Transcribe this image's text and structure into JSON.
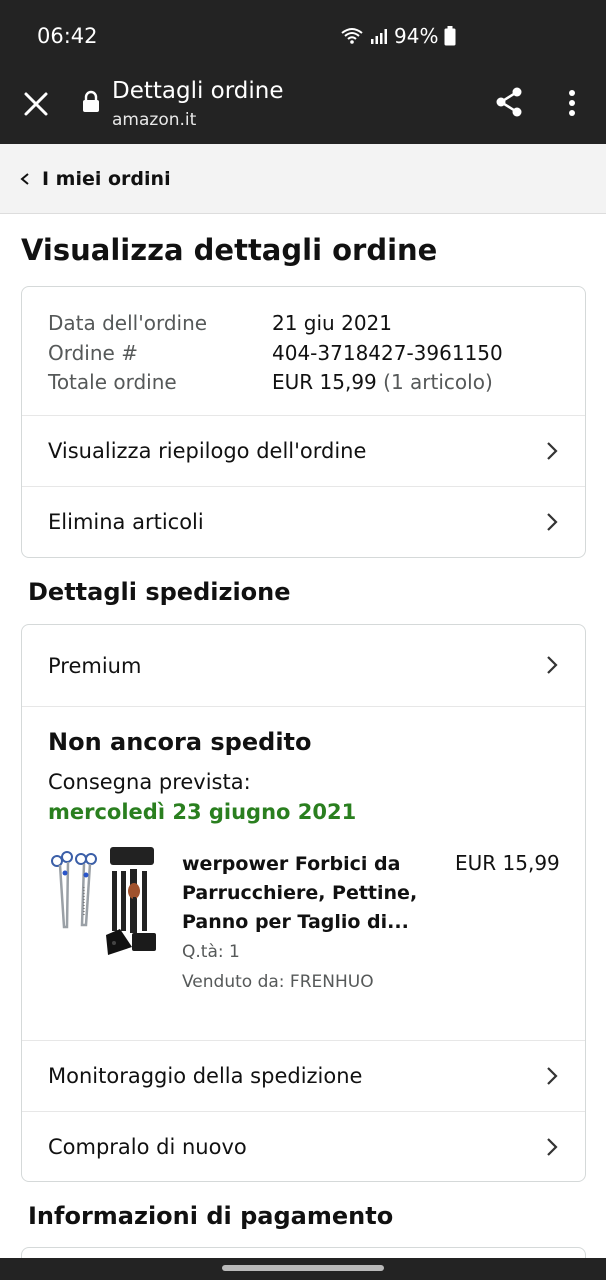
{
  "status_bar": {
    "time": "06:42",
    "battery": "94%"
  },
  "browser": {
    "title": "Dettagli ordine",
    "domain": "amazon.it"
  },
  "breadcrumb": {
    "label": "I miei ordini"
  },
  "page": {
    "title": "Visualizza dettagli ordine"
  },
  "order_summary": {
    "date_label": "Data dell'ordine",
    "date_value": "21 giu 2021",
    "number_label": "Ordine #",
    "number_value": "404-3718427-3961150",
    "total_label": "Totale ordine",
    "total_value": "EUR 15,99",
    "total_items": "(1 articolo)",
    "actions": [
      "Visualizza riepilogo dell'ordine",
      "Elimina articoli"
    ]
  },
  "shipping": {
    "section_title": "Dettagli spedizione",
    "method": "Premium",
    "status": "Non ancora spedito",
    "delivery_label": "Consegna prevista:",
    "delivery_date": "mercoledì 23 giugno 2021",
    "product": {
      "title_line1": "werpower Forbici da",
      "title_line2": "Parrucchiere, Pettine,",
      "title_line3": "Panno per Taglio di...",
      "price": "EUR 15,99",
      "qty": "Q.tà: 1",
      "seller": "Venduto da: FRENHUO"
    },
    "actions": [
      "Monitoraggio della spedizione",
      "Compralo di nuovo"
    ]
  },
  "payment": {
    "section_title": "Informazioni di pagamento"
  },
  "colors": {
    "dark_bar": "#232323",
    "delivery_green": "#2a7f1f",
    "muted": "#565959"
  }
}
